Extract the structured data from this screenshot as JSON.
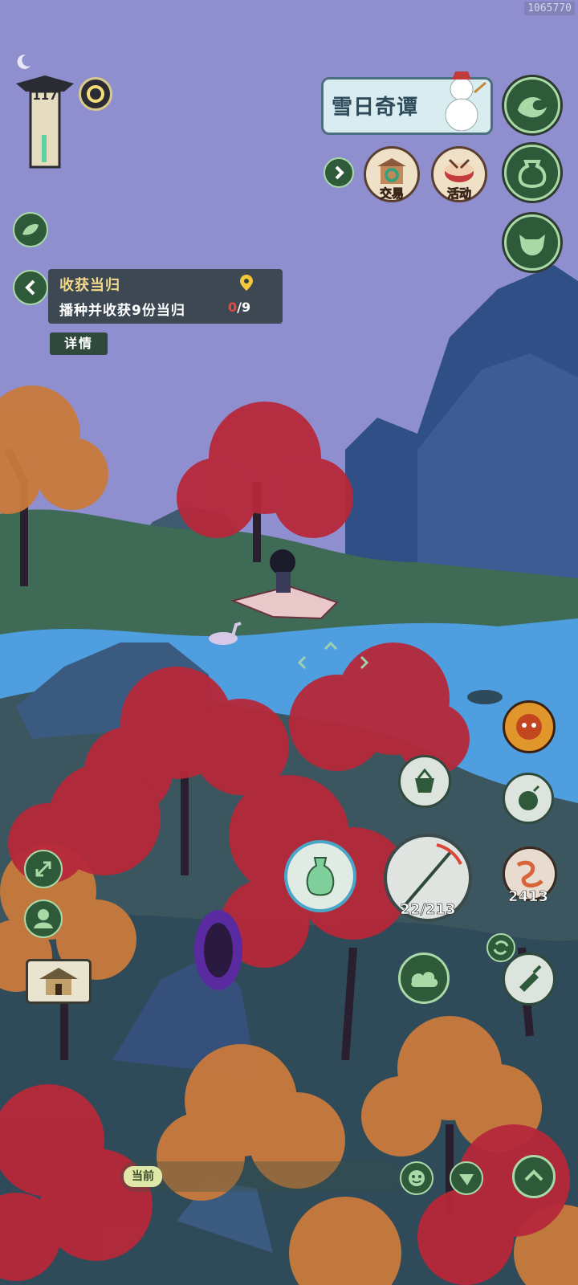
{
  "watermark": "1065770",
  "level": "117",
  "event_banner": {
    "title": "雪日奇谭"
  },
  "events": [
    {
      "label": "交易",
      "icon": "trade-stall-icon"
    },
    {
      "label": "活动",
      "icon": "drum-activity-icon"
    }
  ],
  "quest": {
    "title": "收获当归",
    "description": "播种并收获9份当归",
    "progress_done": "0",
    "progress_total": "/9",
    "detail_button": "详情"
  },
  "tools": {
    "fishing_rod_count": "22/213",
    "bait_count": "2413",
    "current_item": "vase-icon"
  },
  "bottom": {
    "current_label": "当前"
  },
  "colors": {
    "sky": "#8f8fd0",
    "river": "#4f9fe0",
    "mountain": "#2f4f86",
    "red_maple": "#b6283a",
    "orange_maple": "#c97a3c",
    "button_green": "#2f5a3a",
    "button_rim": "#a9d9a6"
  }
}
